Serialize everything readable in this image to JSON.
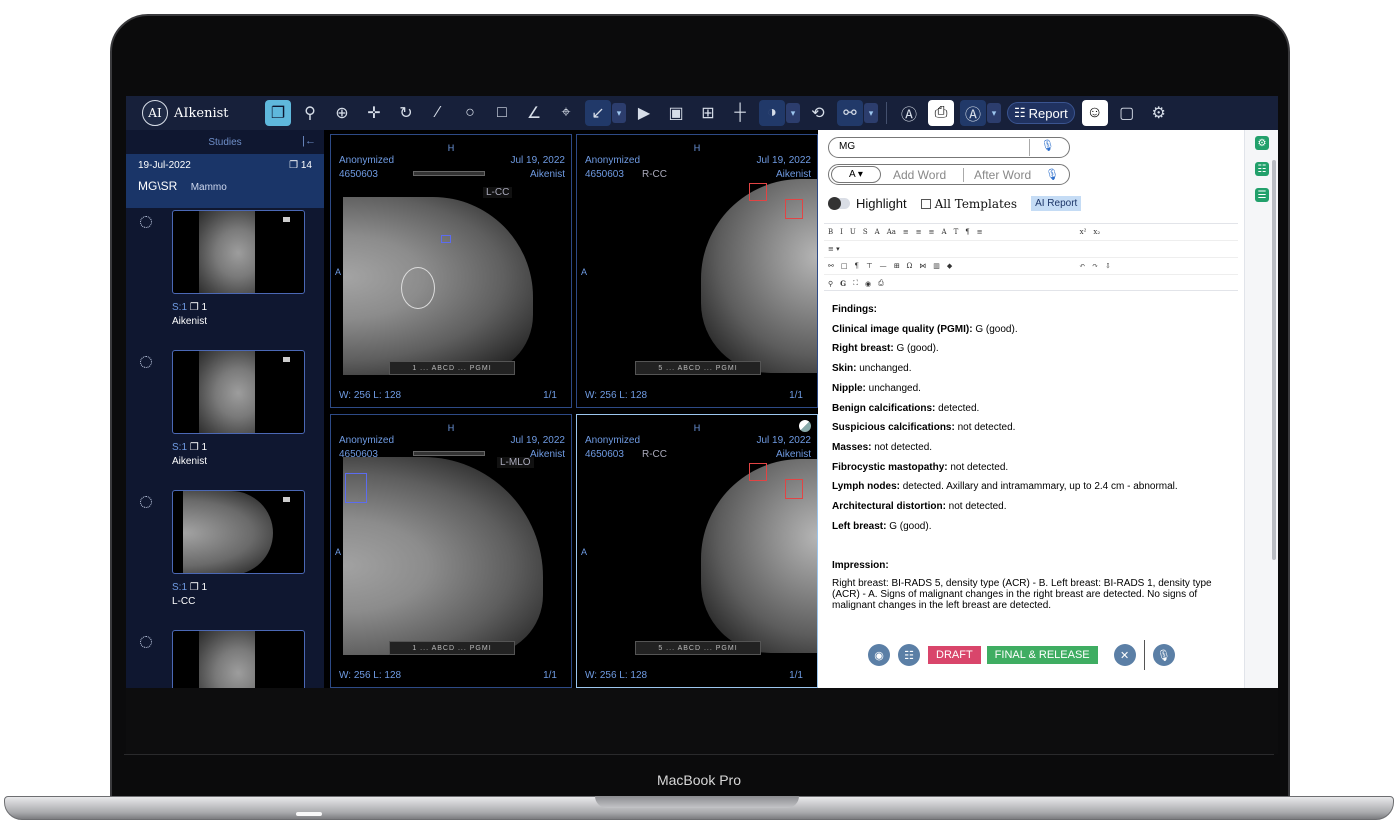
{
  "device": {
    "brand_label": "MacBook Pro"
  },
  "app": {
    "logo_mark": "AI",
    "name": "AIkenist"
  },
  "toolbar": {
    "report_label": "Report",
    "icons": [
      "layout-icon",
      "search-icon",
      "zoom-icon",
      "pan-icon",
      "rotate-icon",
      "ruler-icon",
      "ellipse-roi-icon",
      "rectangle-roi-icon",
      "angle-icon",
      "probe-icon",
      "arrow-annotate-icon",
      "play-icon",
      "camera-icon",
      "grid-icon",
      "crosshair-icon",
      "invert-icon",
      "sync-icon",
      "link-icon",
      "text-annotation-icon",
      "print-icon",
      "ai-icon",
      "report-icon",
      "user-icon",
      "window-icon",
      "settings-icon"
    ]
  },
  "studies": {
    "header": "Studies",
    "study": {
      "date": "19-Jul-2022",
      "count": "14",
      "modality": "MG\\SR",
      "description": "Mammo"
    },
    "series": [
      {
        "s_label": "S:",
        "s_num": "1",
        "count": "1",
        "label": "Aikenist"
      },
      {
        "s_label": "S:",
        "s_num": "1",
        "count": "1",
        "label": "Aikenist"
      },
      {
        "s_label": "S:",
        "s_num": "1",
        "count": "1",
        "label": "L-CC"
      },
      {
        "s_label": "",
        "s_num": "",
        "count": "",
        "label": ""
      }
    ]
  },
  "viewports": [
    {
      "top": "H",
      "patient": "Anonymized",
      "date": "Jul 19, 2022",
      "id": "4650603",
      "institution": "Aikenist",
      "view": "L-CC",
      "side": "A",
      "scale_text": "1 ... ABCD ... PGMI",
      "wl": "W: 256  L: 128",
      "frame": "1/1"
    },
    {
      "top": "H",
      "patient": "Anonymized",
      "date": "Jul 19, 2022",
      "id": "4650603",
      "institution": "Aikenist",
      "view": "R-CC",
      "side": "A",
      "scale_text": "5 ... ABCD ... PGMI",
      "wl": "W: 256  L: 128",
      "frame": "1/1"
    },
    {
      "top": "H",
      "patient": "Anonymized",
      "date": "Jul 19, 2022",
      "id": "4650603",
      "institution": "Aikenist",
      "view": "L-MLO",
      "side": "A",
      "scale_text": "1 ... ABCD ... PGMI",
      "wl": "W: 256  L: 128",
      "frame": "1/1"
    },
    {
      "top": "H",
      "patient": "Anonymized",
      "date": "Jul 19, 2022",
      "id": "4650603",
      "institution": "Aikenist",
      "view": "R-CC",
      "side": "A",
      "scale_text": "5 ... ABCD ... PGMI",
      "wl": "W: 256  L: 128",
      "frame": "1/1"
    }
  ],
  "report": {
    "search_value": "MG",
    "add_word_placeholder": "Add Word",
    "after_word_placeholder": "After Word",
    "highlight_label": "Highlight",
    "all_templates_label": "All Templates",
    "ai_report_label": "AI Report",
    "editor_row1": [
      "B",
      "I",
      "U",
      "S",
      "A",
      "Aa",
      "≡",
      "≡",
      "≡",
      "A",
      "T",
      "¶",
      "≡",
      "x²",
      "x₂"
    ],
    "findings_title": "Findings:",
    "findings": [
      {
        "label": "Clinical image quality (PGMI):",
        "value": " G (good)."
      },
      {
        "label": "Right breast:",
        "value": " G (good)."
      },
      {
        "label": "Skin:",
        "value": " unchanged."
      },
      {
        "label": "Nipple:",
        "value": " unchanged."
      },
      {
        "label": "Benign calcifications:",
        "value": " detected."
      },
      {
        "label": "Suspicious calcifications:",
        "value": " not detected."
      },
      {
        "label": "Masses:",
        "value": " not detected."
      },
      {
        "label": "Fibrocystic mastopathy:",
        "value": " not detected."
      },
      {
        "label": "Lymph nodes:",
        "value": " detected. Axillary and intramammary, up to 2.4 cm - abnormal."
      },
      {
        "label": "Architectural distortion:",
        "value": " not detected."
      },
      {
        "label": "Left breast:",
        "value": " G (good)."
      }
    ],
    "impression_title": "Impression:",
    "impression_text": "Right breast: BI-RADS 5, density type (ACR) - B. Left breast: BI-RADS 1, density type (ACR) - A. Signs of malignant changes in the right breast are detected. No signs of malignant changes in the left breast are detected.",
    "draft_label": "DRAFT",
    "final_label": "FINAL & RELEASE"
  },
  "colors": {
    "toolbar_bg": "#17203a",
    "accent": "#5fb8dc",
    "draft": "#d9456b",
    "final": "#3fad62"
  }
}
